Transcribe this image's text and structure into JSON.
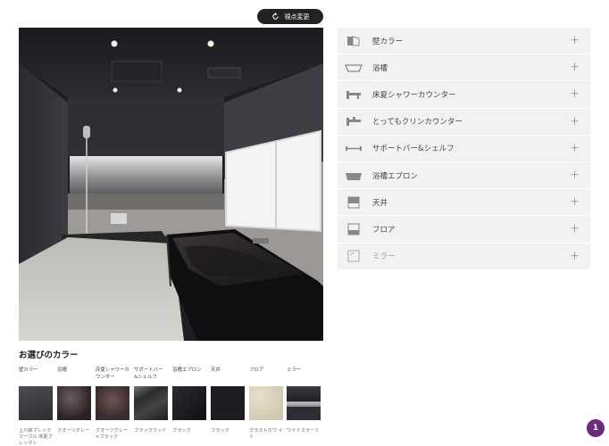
{
  "view_button": {
    "label": "視点変更",
    "icon": "rotate-icon"
  },
  "options": [
    {
      "label": "壁カラー",
      "icon": "wall-icon",
      "enabled": true
    },
    {
      "label": "浴槽",
      "icon": "bathtub-icon",
      "enabled": true
    },
    {
      "label": "床夏シャワーカウンター",
      "icon": "shower-counter-icon",
      "enabled": true
    },
    {
      "label": "とってもクリンカウンター",
      "icon": "clean-counter-icon",
      "enabled": true
    },
    {
      "label": "サポートバー&シェルフ",
      "icon": "support-bar-icon",
      "enabled": true
    },
    {
      "label": "浴槽エプロン",
      "icon": "apron-icon",
      "enabled": true
    },
    {
      "label": "天井",
      "icon": "ceiling-icon",
      "enabled": true
    },
    {
      "label": "フロア",
      "icon": "floor-icon",
      "enabled": true
    },
    {
      "label": "ミラー",
      "icon": "mirror-icon",
      "enabled": false
    }
  ],
  "selection": {
    "title": "お選びのカラー",
    "swatches": [
      {
        "category": "壁カラー",
        "name": "上川鉄ブレックマーブル 床夏ブレックレ",
        "color": "#3a3c40"
      },
      {
        "category": "浴槽",
        "name": "クオーツグレー",
        "color": "#2a2324"
      },
      {
        "category": "床夏シャワーカウンター",
        "name": "クオーツグレー ×ブラック",
        "color": "#3a2c2c"
      },
      {
        "category": "サポートバー &シェルフ",
        "name": "ブラックウッド",
        "color": "#2c2c2e"
      },
      {
        "category": "浴槽エプロン",
        "name": "ブラック",
        "color": "#15161a"
      },
      {
        "category": "天井",
        "name": "ブラック",
        "color": "#1c1d21"
      },
      {
        "category": "フロア",
        "name": "グラストホワ イト",
        "color": "#d8d2bc"
      },
      {
        "category": "ミラー",
        "name": "ワイドスラーミ",
        "color": "#2c2e33"
      }
    ]
  },
  "badge": {
    "count": "1"
  }
}
